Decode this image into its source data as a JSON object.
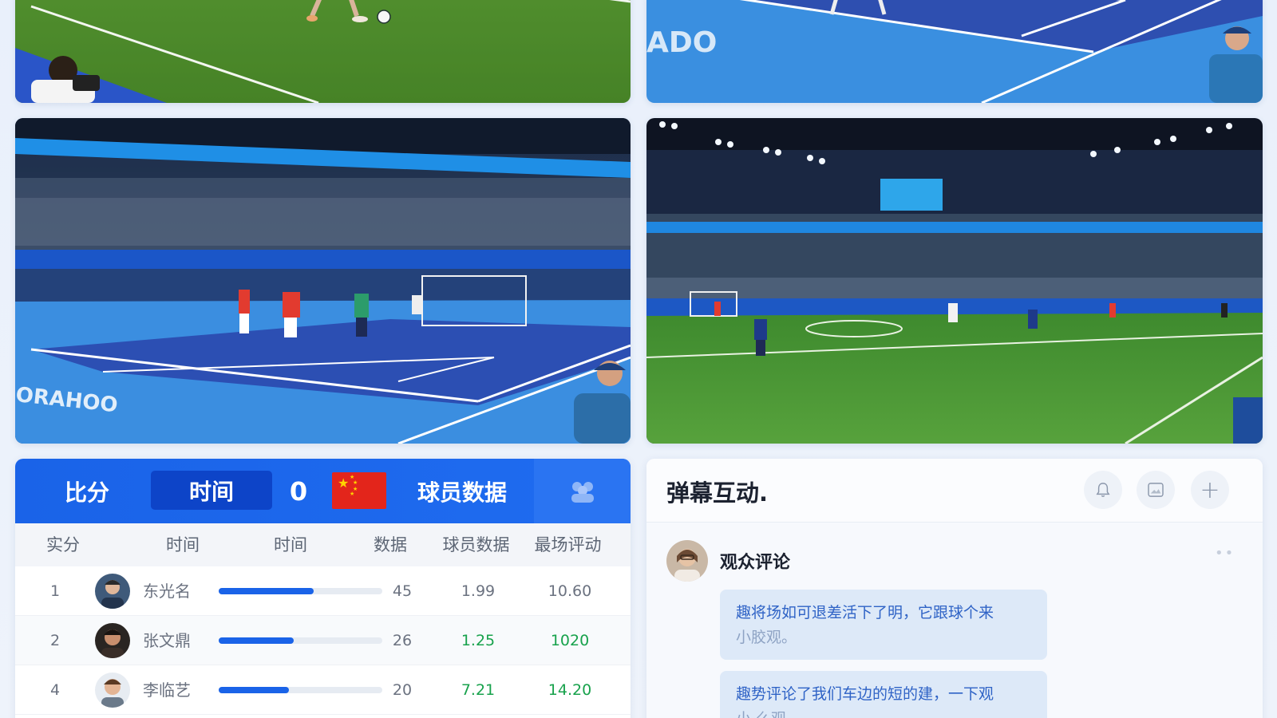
{
  "stats": {
    "header": {
      "score_label": "比分",
      "time_tab": "时间",
      "score_value": "0",
      "players_tab": "球员数据",
      "flag_color": "#e3251b"
    },
    "columns": [
      "实分",
      "时间",
      "时间",
      "数据",
      "球员数据",
      "最场评动"
    ],
    "rows": [
      {
        "rank": "1",
        "name": "东光名",
        "progress": 0.58,
        "bar_value": "45",
        "v1": "1.99",
        "v2": "10.60",
        "highlight": false
      },
      {
        "rank": "2",
        "name": "张文鼎",
        "progress": 0.46,
        "bar_value": "26",
        "v1": "1.25",
        "v2": "1020",
        "highlight": true
      },
      {
        "rank": "4",
        "name": "李临艺",
        "progress": 0.43,
        "bar_value": "20",
        "v1": "7.21",
        "v2": "14.20",
        "highlight": true
      }
    ],
    "accent_color": "#1a63e8",
    "positive_color": "#18a24c"
  },
  "chat": {
    "title": "弹幕互动.",
    "icons": [
      "bell-icon",
      "image-icon",
      "plus-icon"
    ],
    "add_symbol": "+",
    "commenter": "观众评论",
    "more": "••",
    "messages": [
      {
        "line1": "趣将场如可退差活下了明，它跟球个来",
        "line2": "小胶观。"
      },
      {
        "line1": "趣势评论了我们车边的短的建，一下观",
        "line2": "小 么观"
      }
    ]
  }
}
